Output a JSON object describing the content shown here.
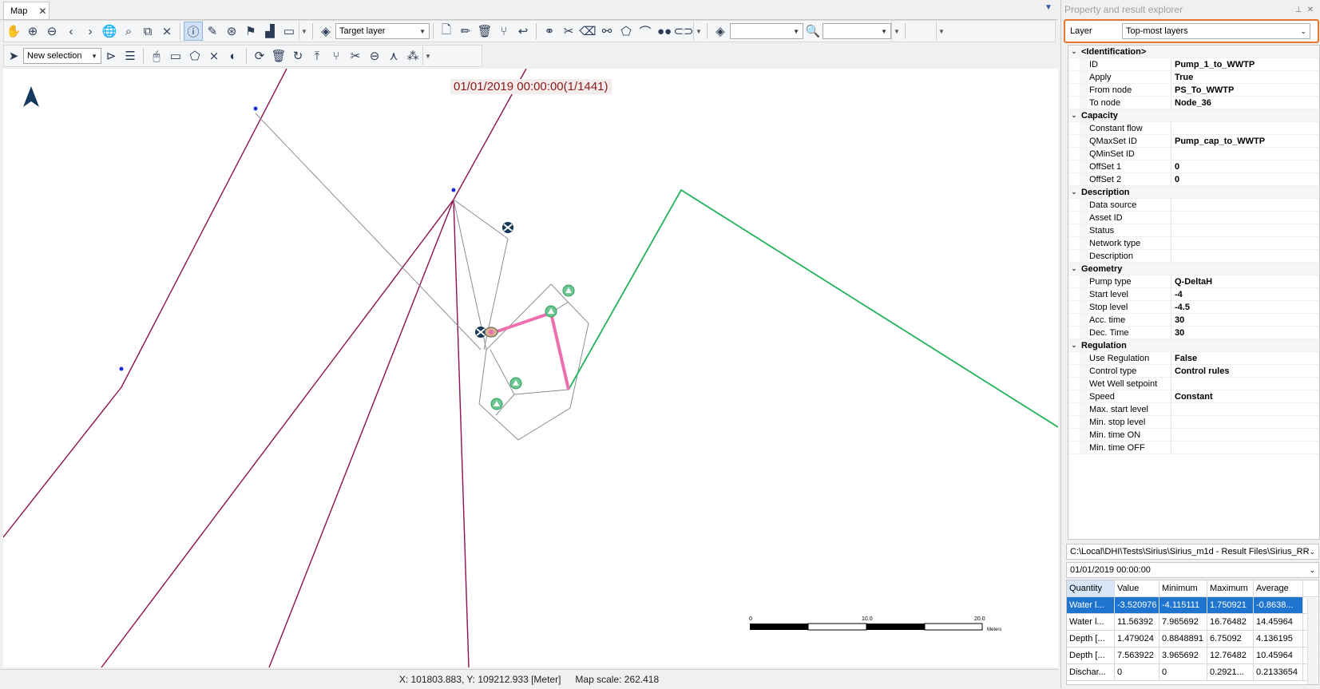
{
  "map_tab": {
    "label": "Map",
    "close": "✕"
  },
  "toolbar1": {
    "target_layer": "Target layer",
    "layer_combo": "",
    "search_combo": ""
  },
  "toolbar2": {
    "selection_mode": "New selection"
  },
  "map": {
    "timestamp": "01/01/2019 00:00:00(1/1441)",
    "scale_labels": [
      "0",
      "10.0",
      "20.0"
    ],
    "scale_unit": "Meters",
    "colors": {
      "pump": "#ee6fb0",
      "green_line": "#22b35a",
      "purple_line": "#8c1150",
      "gray_line": "#8a8f96"
    }
  },
  "status": {
    "coords": "X: 101803.883, Y: 109212.933 [Meter]",
    "scale": "Map scale: 262.418"
  },
  "explorer": {
    "title": "Property and result explorer",
    "layer_label": "Layer",
    "layer_value": "Top-most layers",
    "properties": [
      {
        "kind": "cat",
        "label": "<Identification>"
      },
      {
        "kind": "prop",
        "name": "ID",
        "value": "Pump_1_to_WWTP"
      },
      {
        "kind": "prop",
        "name": "Apply",
        "value": "True"
      },
      {
        "kind": "prop",
        "name": "From node",
        "value": "PS_To_WWTP"
      },
      {
        "kind": "prop",
        "name": "To node",
        "value": "Node_36"
      },
      {
        "kind": "cat",
        "label": "Capacity"
      },
      {
        "kind": "prop",
        "name": "Constant flow",
        "value": ""
      },
      {
        "kind": "prop",
        "name": "QMaxSet ID",
        "value": "Pump_cap_to_WWTP"
      },
      {
        "kind": "prop",
        "name": "QMinSet ID",
        "value": ""
      },
      {
        "kind": "prop",
        "name": "OffSet 1",
        "value": "0"
      },
      {
        "kind": "prop",
        "name": "OffSet 2",
        "value": "0"
      },
      {
        "kind": "cat",
        "label": "Description"
      },
      {
        "kind": "prop",
        "name": "Data source",
        "value": ""
      },
      {
        "kind": "prop",
        "name": "Asset ID",
        "value": ""
      },
      {
        "kind": "prop",
        "name": "Status",
        "value": ""
      },
      {
        "kind": "prop",
        "name": "Network type",
        "value": ""
      },
      {
        "kind": "prop",
        "name": "Description",
        "value": ""
      },
      {
        "kind": "cat",
        "label": "Geometry"
      },
      {
        "kind": "prop",
        "name": "Pump type",
        "value": "Q-DeltaH"
      },
      {
        "kind": "prop",
        "name": "Start level",
        "value": "-4"
      },
      {
        "kind": "prop",
        "name": "Stop level",
        "value": "-4.5"
      },
      {
        "kind": "prop",
        "name": "Acc. time",
        "value": "30"
      },
      {
        "kind": "prop",
        "name": "Dec. Time",
        "value": "30"
      },
      {
        "kind": "cat",
        "label": "Regulation"
      },
      {
        "kind": "prop",
        "name": "Use Regulation",
        "value": "False"
      },
      {
        "kind": "prop",
        "name": "Control type",
        "value": "Control rules"
      },
      {
        "kind": "prop",
        "name": "Wet Well setpoint",
        "value": ""
      },
      {
        "kind": "prop",
        "name": "Speed",
        "value": "Constant"
      },
      {
        "kind": "prop",
        "name": "Max. start level",
        "value": ""
      },
      {
        "kind": "prop",
        "name": "Min. stop level",
        "value": ""
      },
      {
        "kind": "prop",
        "name": "Min. time ON",
        "value": ""
      },
      {
        "kind": "prop",
        "name": "Min. time OFF",
        "value": ""
      }
    ],
    "result_file": "C:\\Local\\DHI\\Tests\\Sirius\\Sirius_m1d - Result Files\\Sirius_RR_",
    "result_time": "01/01/2019 00:00:00",
    "results": {
      "headers": [
        "Quantity",
        "Value",
        "Minimum",
        "Maximum",
        "Average"
      ],
      "rows": [
        [
          "Water l...",
          "-3.520976",
          "-4.115111",
          "1.750921",
          "-0.8638..."
        ],
        [
          "Water l...",
          "11.56392",
          "7.965692",
          "16.76482",
          "14.45964"
        ],
        [
          "Depth [...",
          "1.479024",
          "0.8848891",
          "6.75092",
          "4.136195"
        ],
        [
          "Depth [...",
          "7.563922",
          "3.965692",
          "12.76482",
          "10.45964"
        ],
        [
          "Dischar...",
          "0",
          "0",
          "0.2921...",
          "0.2133654"
        ]
      ]
    }
  }
}
